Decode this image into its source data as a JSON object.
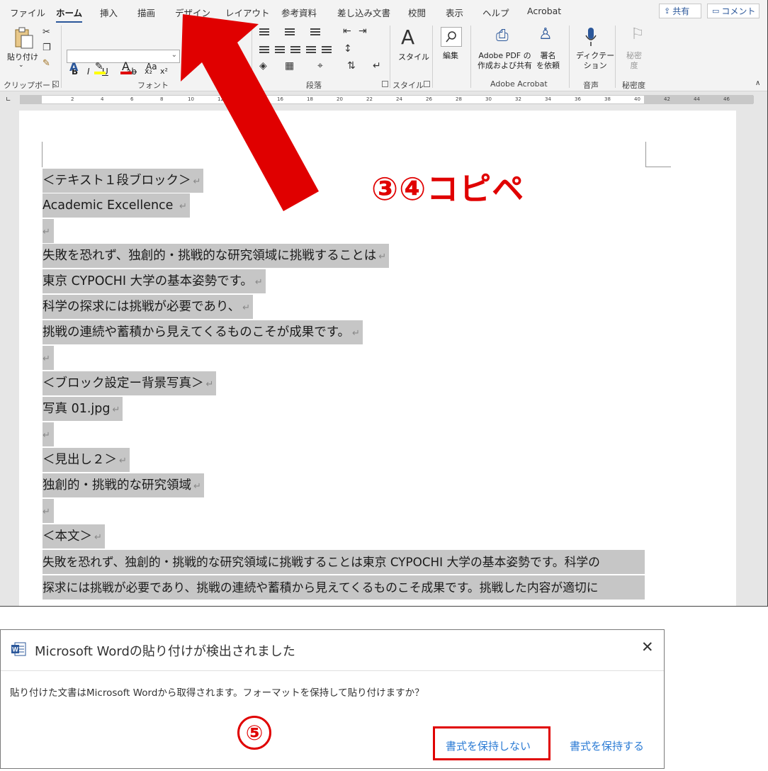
{
  "tabs": [
    "ファイル",
    "ホーム",
    "挿入",
    "描画",
    "デザイン",
    "レイアウト",
    "参考資料",
    "差し込み文書",
    "校閲",
    "表示",
    "ヘルプ",
    "Acrobat"
  ],
  "active_tab": "ホーム",
  "top_buttons": {
    "share": "共有",
    "comment": "コメント"
  },
  "ribbon": {
    "clipboard": {
      "paste": "貼り付け",
      "label": "クリップボード"
    },
    "font": {
      "label": "フォント",
      "bold": "B",
      "italic": "I",
      "underline": "U",
      "strike": "ab",
      "sub": "x₂",
      "sup": "x²",
      "case": "Aa"
    },
    "paragraph": {
      "label": "段落"
    },
    "styles": {
      "button": "スタイル",
      "label": "スタイル"
    },
    "editing": {
      "button": "編集"
    },
    "acrobat": {
      "create_line1": "Adobe PDF の",
      "create_line2": "作成および共有",
      "sign_line1": "署名",
      "sign_line2": "を依頼",
      "label": "Adobe Acrobat"
    },
    "voice": {
      "dictate_line1": "ディクテー",
      "dictate_line2": "ション",
      "label": "音声"
    },
    "sensitivity": {
      "button_line1": "秘密",
      "button_line2": "度",
      "label": "秘密度"
    }
  },
  "ruler_numbers": [
    "2",
    "4",
    "6",
    "8",
    "10",
    "12",
    "14",
    "16",
    "18",
    "20",
    "22",
    "24",
    "26",
    "28",
    "30",
    "32",
    "34",
    "36",
    "38",
    "40",
    "42",
    "44",
    "46"
  ],
  "document_lines": [
    "＜テキスト１段ブロック＞",
    "Academic Excellence ",
    "",
    "失敗を恐れず、独創的・挑戦的な研究領域に挑戦することは",
    "東京 CYPOCHI 大学の基本姿勢です。",
    "科学の探求には挑戦が必要であり、",
    "挑戦の連続や蓄積から見えてくるものこそが成果です。",
    "",
    "＜ブロック設定ー背景写真＞",
    "写真 01.jpg",
    "",
    "＜見出し２＞",
    "独創的・挑戦的な研究領域",
    "",
    "＜本文＞",
    "失敗を恐れず、独創的・挑戦的な研究領域に挑戦することは東京 CYPOCHI 大学の基本姿勢です。科学の",
    "探求には挑戦が必要であり、挑戦の連続や蓄積から見えてくるものこそ成果です。挑戦した内容が適切に"
  ],
  "paragraph_mark": "↵",
  "annotation_copy": "③④コピペ",
  "annotation_step5": "⑤",
  "dialog": {
    "title": "Microsoft Wordの貼り付けが検出されました",
    "message": "貼り付けた文書はMicrosoft Wordから取得されます。フォーマットを保持して貼り付けますか？",
    "no_keep_button": "書式を保持しない",
    "keep_button": "書式を保持する",
    "close": "✕",
    "logo_letter": "W"
  },
  "colors": {
    "accent": "#2b579a",
    "annotation": "#e00000",
    "link": "#2b7bd4",
    "highlight": "#c6c6c6"
  }
}
